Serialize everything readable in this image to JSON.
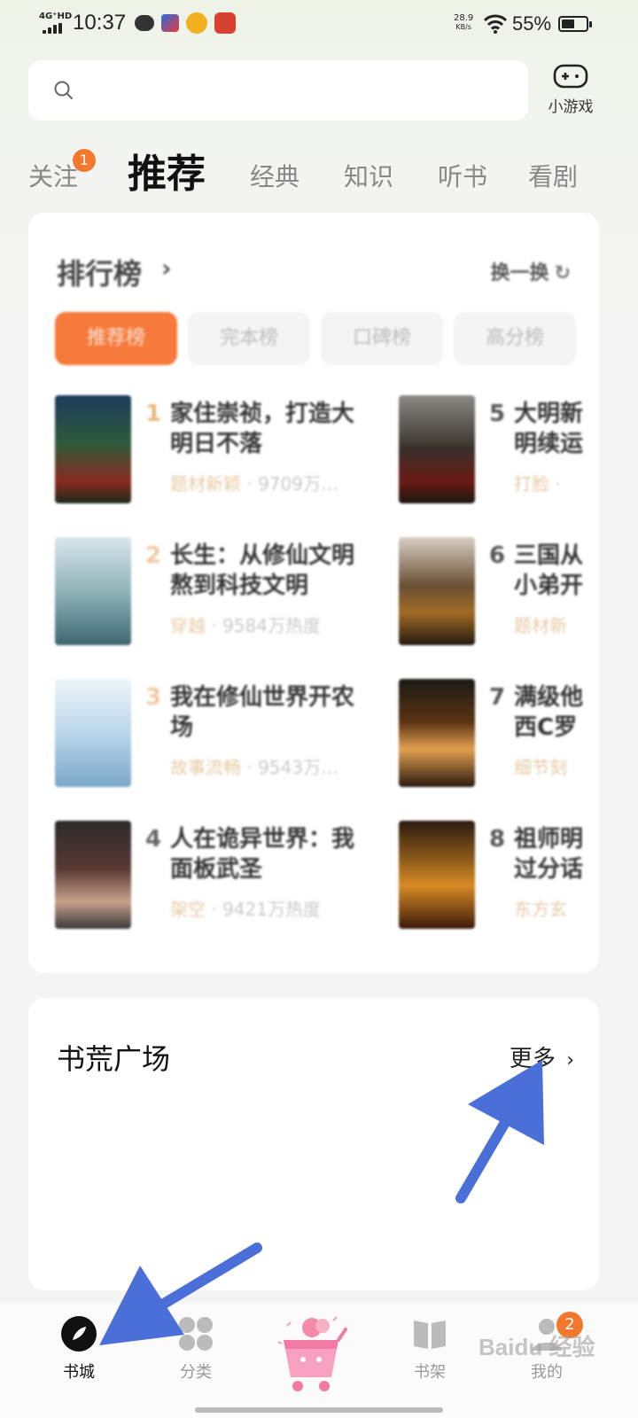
{
  "status_bar": {
    "network": "4G⁺HD",
    "time": "10:37",
    "speed_value": "28.9",
    "speed_unit": "KB/s",
    "battery": "55%",
    "battery_level": 0.55
  },
  "header": {
    "search_placeholder": "",
    "games_label": "小游戏"
  },
  "tabs": [
    {
      "label": "关注",
      "badge": "1"
    },
    {
      "label": "推荐",
      "active": true
    },
    {
      "label": "经典"
    },
    {
      "label": "知识"
    },
    {
      "label": "听书"
    },
    {
      "label": "看剧"
    }
  ],
  "ranking": {
    "title": "排行榜",
    "chevron": "›",
    "refresh": "换一换",
    "tabs": [
      "推荐榜",
      "完本榜",
      "口碑榜",
      "高分榜"
    ],
    "books": [
      {
        "rank": "1",
        "title": "家住崇祯，打造大明日不落",
        "tag": "题材新颖",
        "heat": "9709万…"
      },
      {
        "rank": "2",
        "title": "长生：从修仙文明熬到科技文明",
        "tag": "穿越",
        "heat": "9584万热度"
      },
      {
        "rank": "3",
        "title": "我在修仙世界开农场",
        "tag": "故事流畅",
        "heat": "9543万…"
      },
      {
        "rank": "4",
        "title": "人在诡异世界：我面板武圣",
        "tag": "架空",
        "heat": "9421万热度"
      },
      {
        "rank": "5",
        "title": "大明新明续运",
        "tag": "打脸",
        "heat": "·"
      },
      {
        "rank": "6",
        "title": "三国从小弟开",
        "tag": "题材新",
        "heat": ""
      },
      {
        "rank": "7",
        "title": "满级他西C罗",
        "tag": "细节刻",
        "heat": ""
      },
      {
        "rank": "8",
        "title": "祖师明过分话",
        "tag": "东方玄",
        "heat": ""
      }
    ]
  },
  "plaza": {
    "title": "书荒广场",
    "more": "更多",
    "more_chevron": "›"
  },
  "bottom_nav": {
    "items": [
      "书城",
      "分类",
      "书架",
      "我的"
    ],
    "badge": "2"
  },
  "watermark": "Baidu 经验",
  "colors": {
    "accent": "#f77a3c",
    "badge": "#f4772e",
    "annotation_arrow": "#4a6fd8"
  }
}
